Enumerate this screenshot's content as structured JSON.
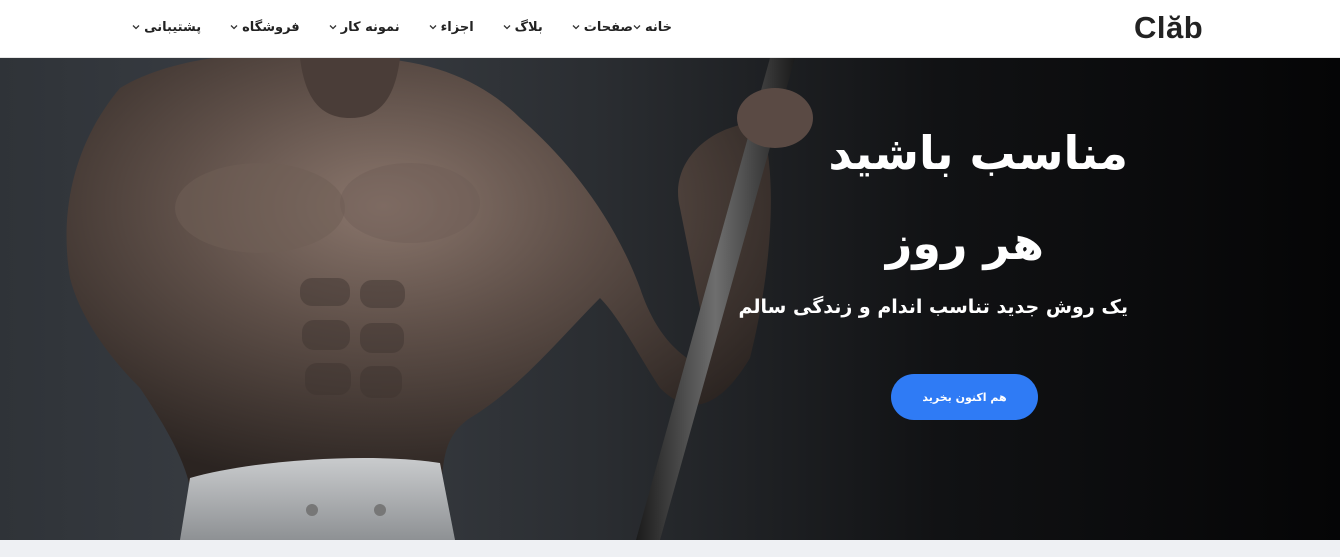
{
  "brand": {
    "logo_text": "Clăb"
  },
  "nav": {
    "items": [
      {
        "label": "خانه"
      },
      {
        "label": "صفحات"
      },
      {
        "label": "بلاگ"
      },
      {
        "label": "اجزاء"
      },
      {
        "label": "نمونه کار"
      },
      {
        "label": "فروشگاه"
      },
      {
        "label": "پشتیبانی"
      }
    ]
  },
  "hero": {
    "headline_line1": "مناسب باشید",
    "headline_line2": "هر روز",
    "subheadline": "یک روش جدید تناسب اندام و زندگی سالم",
    "cta_label": "هم اکنون بخرید",
    "image_description_icon": "athlete-photo"
  },
  "colors": {
    "accent": "#2f7bf5",
    "hero_bg": "#0a0a0b",
    "nav_text": "#222222",
    "page_bg": "#eef0f3"
  }
}
